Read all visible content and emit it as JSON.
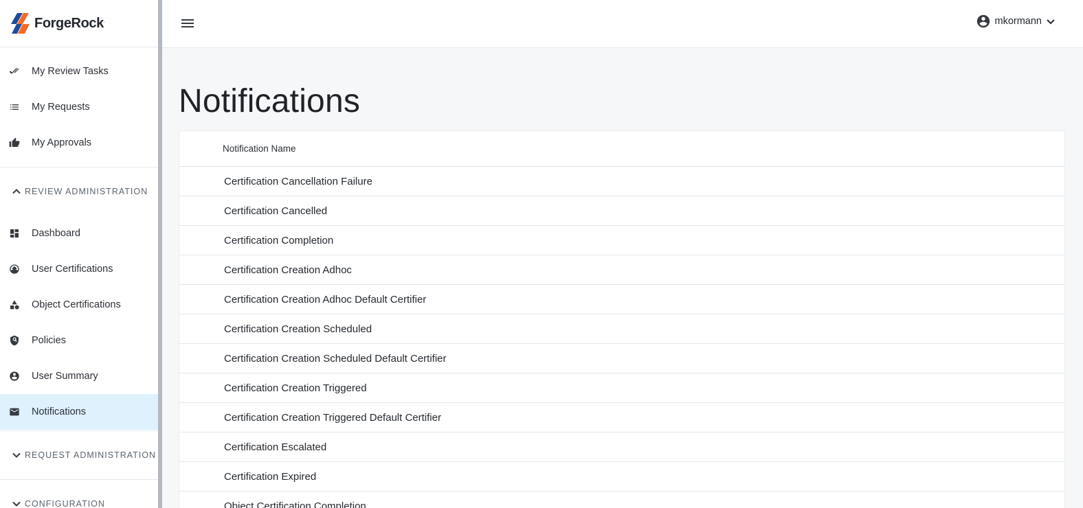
{
  "brand": {
    "name": "ForgeRock",
    "mark": "."
  },
  "sidebar": {
    "top_items": [
      {
        "label": "My Review Tasks",
        "icon": "double-check-icon"
      },
      {
        "label": "My Requests",
        "icon": "list-icon"
      },
      {
        "label": "My Approvals",
        "icon": "thumb-up-icon"
      }
    ],
    "review_admin": {
      "title": "REVIEW ADMINISTRATION",
      "expanded": true,
      "items": [
        {
          "label": "Dashboard",
          "icon": "dashboard-icon"
        },
        {
          "label": "User Certifications",
          "icon": "user-certification-icon"
        },
        {
          "label": "Object Certifications",
          "icon": "shapes-icon"
        },
        {
          "label": "Policies",
          "icon": "policy-shield-icon"
        },
        {
          "label": "User Summary",
          "icon": "account-circle-icon"
        },
        {
          "label": "Notifications",
          "icon": "mail-icon",
          "active": true
        }
      ]
    },
    "request_admin": {
      "title": "REQUEST ADMINISTRATION",
      "expanded": false
    },
    "configuration": {
      "title": "CONFIGURATION",
      "expanded": false
    }
  },
  "header": {
    "username": "mkormann",
    "menu_icon": "hamburger-icon",
    "avatar_icon": "account-circle-icon"
  },
  "main": {
    "title": "Notifications",
    "table": {
      "column": "Notification Name",
      "rows": [
        "Certification Cancellation Failure",
        "Certification Cancelled",
        "Certification Completion",
        "Certification Creation Adhoc",
        "Certification Creation Adhoc Default Certifier",
        "Certification Creation Scheduled",
        "Certification Creation Scheduled Default Certifier",
        "Certification Creation Triggered",
        "Certification Creation Triggered Default Certifier",
        "Certification Escalated",
        "Certification Expired",
        "Object Certification Completion"
      ]
    }
  },
  "colors": {
    "active_bg": "#dff1fd",
    "logo_orange": "#f46a25",
    "logo_blue": "#1f4c9c"
  }
}
